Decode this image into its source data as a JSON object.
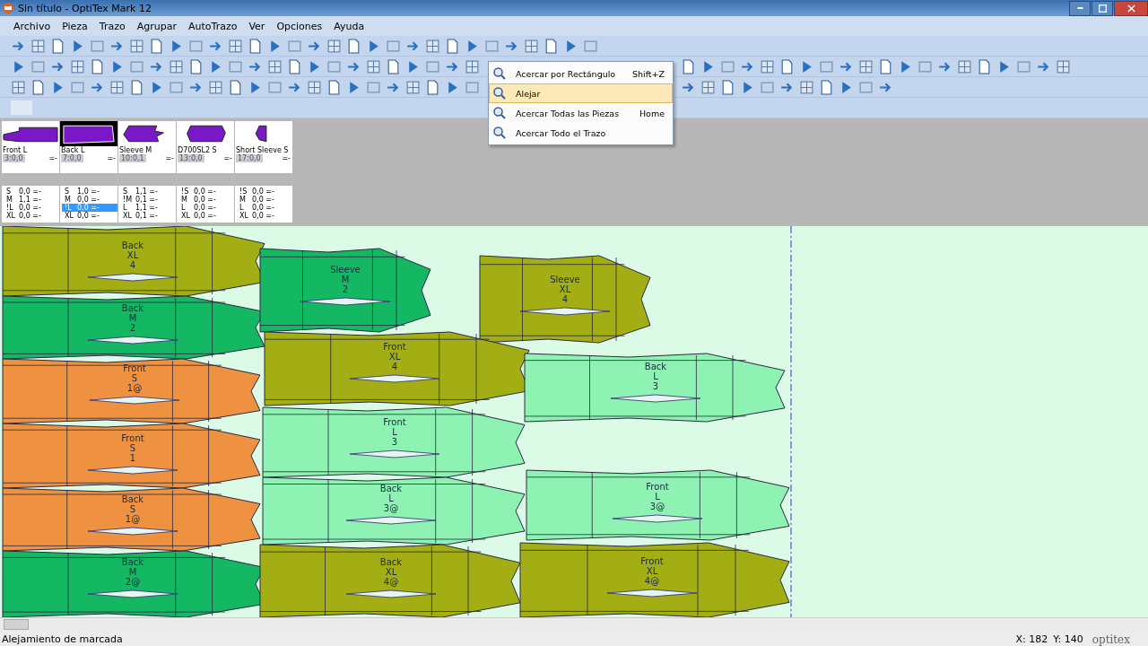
{
  "window": {
    "title": "Sin título - OptiTex Mark 12"
  },
  "menu": [
    "Archivo",
    "Pieza",
    "Trazo",
    "Agrupar",
    "AutoTrazo",
    "Ver",
    "Opciones",
    "Ayuda"
  ],
  "pieces_bar": [
    {
      "name": "Front L",
      "code": "3:0,0",
      "suffix": "=-",
      "selected": false,
      "sizes": [
        {
          "label": "S",
          "value": "0,0 =-",
          "selected": false
        },
        {
          "label": "M",
          "value": "1,1 =-",
          "selected": false
        },
        {
          "label": "!L",
          "value": "0,0 =-",
          "selected": false
        },
        {
          "label": "XL",
          "value": "0,0 =-",
          "selected": false
        }
      ]
    },
    {
      "name": "Back L",
      "code": "7:0,0",
      "suffix": "=-",
      "selected": true,
      "sizes": [
        {
          "label": "S",
          "value": "1,0 =-",
          "selected": false
        },
        {
          "label": "M",
          "value": "0,0 =-",
          "selected": false
        },
        {
          "label": "!L",
          "value": "0,0 =-",
          "selected": true
        },
        {
          "label": "XL",
          "value": "0,0 =-",
          "selected": false
        }
      ]
    },
    {
      "name": "Sleeve M",
      "code": "10:0,1",
      "suffix": "=-",
      "selected": false,
      "sizes": [
        {
          "label": "S",
          "value": "1,1 =-",
          "selected": false
        },
        {
          "label": "!M",
          "value": "0,1 =-",
          "selected": false
        },
        {
          "label": "L",
          "value": "1,1 =-",
          "selected": false
        },
        {
          "label": "XL",
          "value": "0,1 =-",
          "selected": false
        }
      ]
    },
    {
      "name": "D700SL2 S",
      "code": "13:0,0",
      "suffix": "=-",
      "selected": false,
      "sizes": [
        {
          "label": "!S",
          "value": "0,0 =-",
          "selected": false
        },
        {
          "label": "M",
          "value": "0,0 =-",
          "selected": false
        },
        {
          "label": "L",
          "value": "0,0 =-",
          "selected": false
        },
        {
          "label": "XL",
          "value": "0,0 =-",
          "selected": false
        }
      ]
    },
    {
      "name": "Short Sleeve S",
      "code": "17:0,0",
      "suffix": "=-",
      "selected": false,
      "sizes": [
        {
          "label": "!S",
          "value": "0,0 =-",
          "selected": false
        },
        {
          "label": "M",
          "value": "0,0 =-",
          "selected": false
        },
        {
          "label": "L",
          "value": "0,0 =-",
          "selected": false
        },
        {
          "label": "XL",
          "value": "0,0 =-",
          "selected": false
        }
      ]
    }
  ],
  "marker": [
    {
      "name": "Back",
      "size": "XL",
      "number": "4",
      "color": "#a3ae14"
    },
    {
      "name": "Back",
      "size": "M",
      "number": "2",
      "color": "#14b862"
    },
    {
      "name": "Front",
      "size": "S",
      "number": "1@",
      "color": "#ee9242"
    },
    {
      "name": "Front",
      "size": "S",
      "number": "1",
      "color": "#ee9242"
    },
    {
      "name": "Back",
      "size": "S",
      "number": "1@",
      "color": "#ee9242"
    },
    {
      "name": "Back",
      "size": "M",
      "number": "2@",
      "color": "#14b862"
    },
    {
      "name": "Sleeve",
      "size": "M",
      "number": "2",
      "color": "#14b862"
    },
    {
      "name": "Sleeve",
      "size": "XL",
      "number": "4",
      "color": "#a3ae14"
    },
    {
      "name": "Front",
      "size": "XL",
      "number": "4",
      "color": "#a3ae14"
    },
    {
      "name": "Back",
      "size": "L",
      "number": "3",
      "color": "#8ef2b2"
    },
    {
      "name": "Front",
      "size": "L",
      "number": "3",
      "color": "#8ef2b2"
    },
    {
      "name": "Back",
      "size": "L",
      "number": "3@",
      "color": "#8ef2b2"
    },
    {
      "name": "Front",
      "size": "L",
      "number": "3@",
      "color": "#8ef2b2"
    },
    {
      "name": "Back",
      "size": "XL",
      "number": "4@",
      "color": "#a3ae14"
    },
    {
      "name": "Front",
      "size": "XL",
      "number": "4@",
      "color": "#a3ae14"
    }
  ],
  "zoom_menu": [
    {
      "label": "Acercar por Rectángulo",
      "shortcut": "Shift+Z",
      "selected": false
    },
    {
      "label": "Alejar",
      "selected": true
    },
    {
      "label": "Acercar Todas las Piezas",
      "shortcut": "Home",
      "selected": false
    },
    {
      "label": "Acercar Todo el Trazo",
      "selected": false
    }
  ],
  "status_bar": {
    "message": "Alejamiento de marcada",
    "x": "X: 182",
    "y": "Y: 140",
    "brand": "optitex"
  }
}
